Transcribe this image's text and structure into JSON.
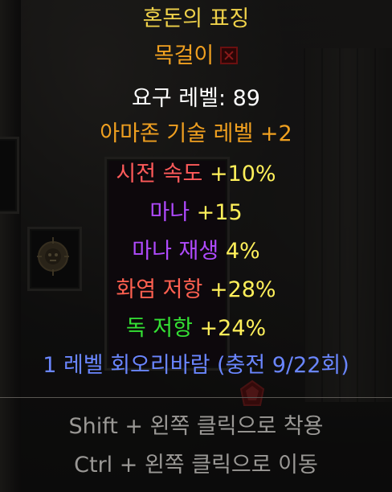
{
  "item": {
    "name": "혼돈의 표징",
    "type": "목걸이",
    "requirement": "요구 레벨: 89",
    "skill_bonus": "아마존 기술 레벨 +2",
    "stats": [
      {
        "label": "시전 속도",
        "value": "+10%"
      },
      {
        "label": "마나",
        "value": "+15"
      },
      {
        "label": "마나 재생",
        "value": "4%"
      },
      {
        "label": "화염 저항",
        "value": "+28%"
      },
      {
        "label": "독 저항",
        "value": "+24%"
      }
    ],
    "charges": "1 레벨 회오리바람 (충전 9/22회)"
  },
  "hints": {
    "equip": "Shift + 왼쪽 클릭으로 착용",
    "move": "Ctrl + 왼쪽 클릭으로 이동"
  },
  "icons": {
    "unique_marker": "close-icon",
    "amulet": "amulet-icon",
    "gem": "ruby-gem-icon"
  },
  "colors": {
    "unique_gold": "#f0d24a",
    "rare_orange": "#f0a020",
    "normal_white": "#ffffff",
    "stat_value_yellow": "#fff05a",
    "cast_speed_red": "#ff5a5a",
    "mana_purple": "#b04aff",
    "fire_res_red": "#ff6050",
    "poison_green": "#34e034",
    "charges_blue": "#6a86ff",
    "hint_gray": "#9a9895"
  }
}
